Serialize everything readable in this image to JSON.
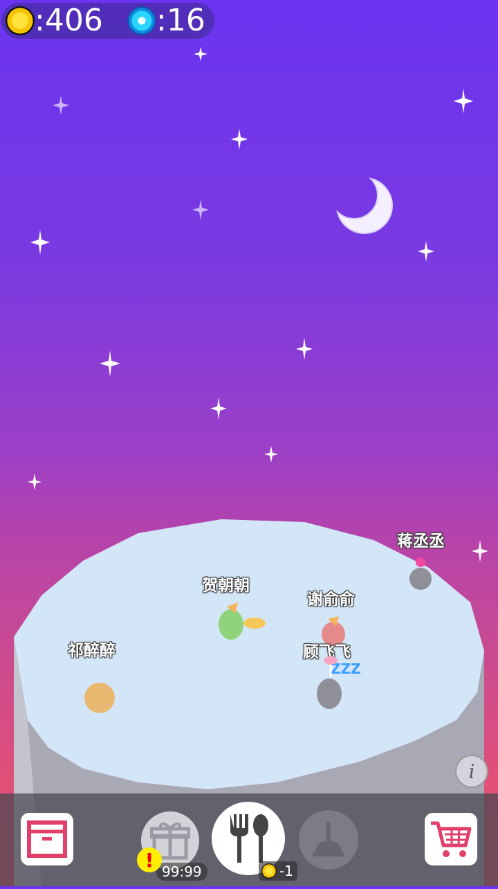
{
  "hud": {
    "coins_label": ":406",
    "gems_label": ":16",
    "coin_icon": "gold-coin-icon",
    "gem_icon": "blue-gem-icon"
  },
  "characters": [
    {
      "name": "蒋丞丞"
    },
    {
      "name": "贺朝朝"
    },
    {
      "name": "谢俞俞"
    },
    {
      "name": "顾飞飞",
      "status": "ZZZ"
    },
    {
      "name": "祁醉醉"
    }
  ],
  "toolbar": {
    "inventory_icon": "storage-box-icon",
    "gift_icon": "gift-box-icon",
    "gift_timer": "99:99",
    "gift_alert": "!",
    "feed_icon": "fork-spoon-icon",
    "feed_cost": "-1",
    "clean_icon": "plunger-icon",
    "shop_icon": "shopping-cart-icon"
  },
  "info_glyph": "i",
  "colors": {
    "sky_top": "#6a34f0",
    "sky_bottom": "#ea5470",
    "island_top": "#cfe3f6",
    "island_side": "#b8b8c4",
    "toolbar_bg": "#4a4a52"
  }
}
